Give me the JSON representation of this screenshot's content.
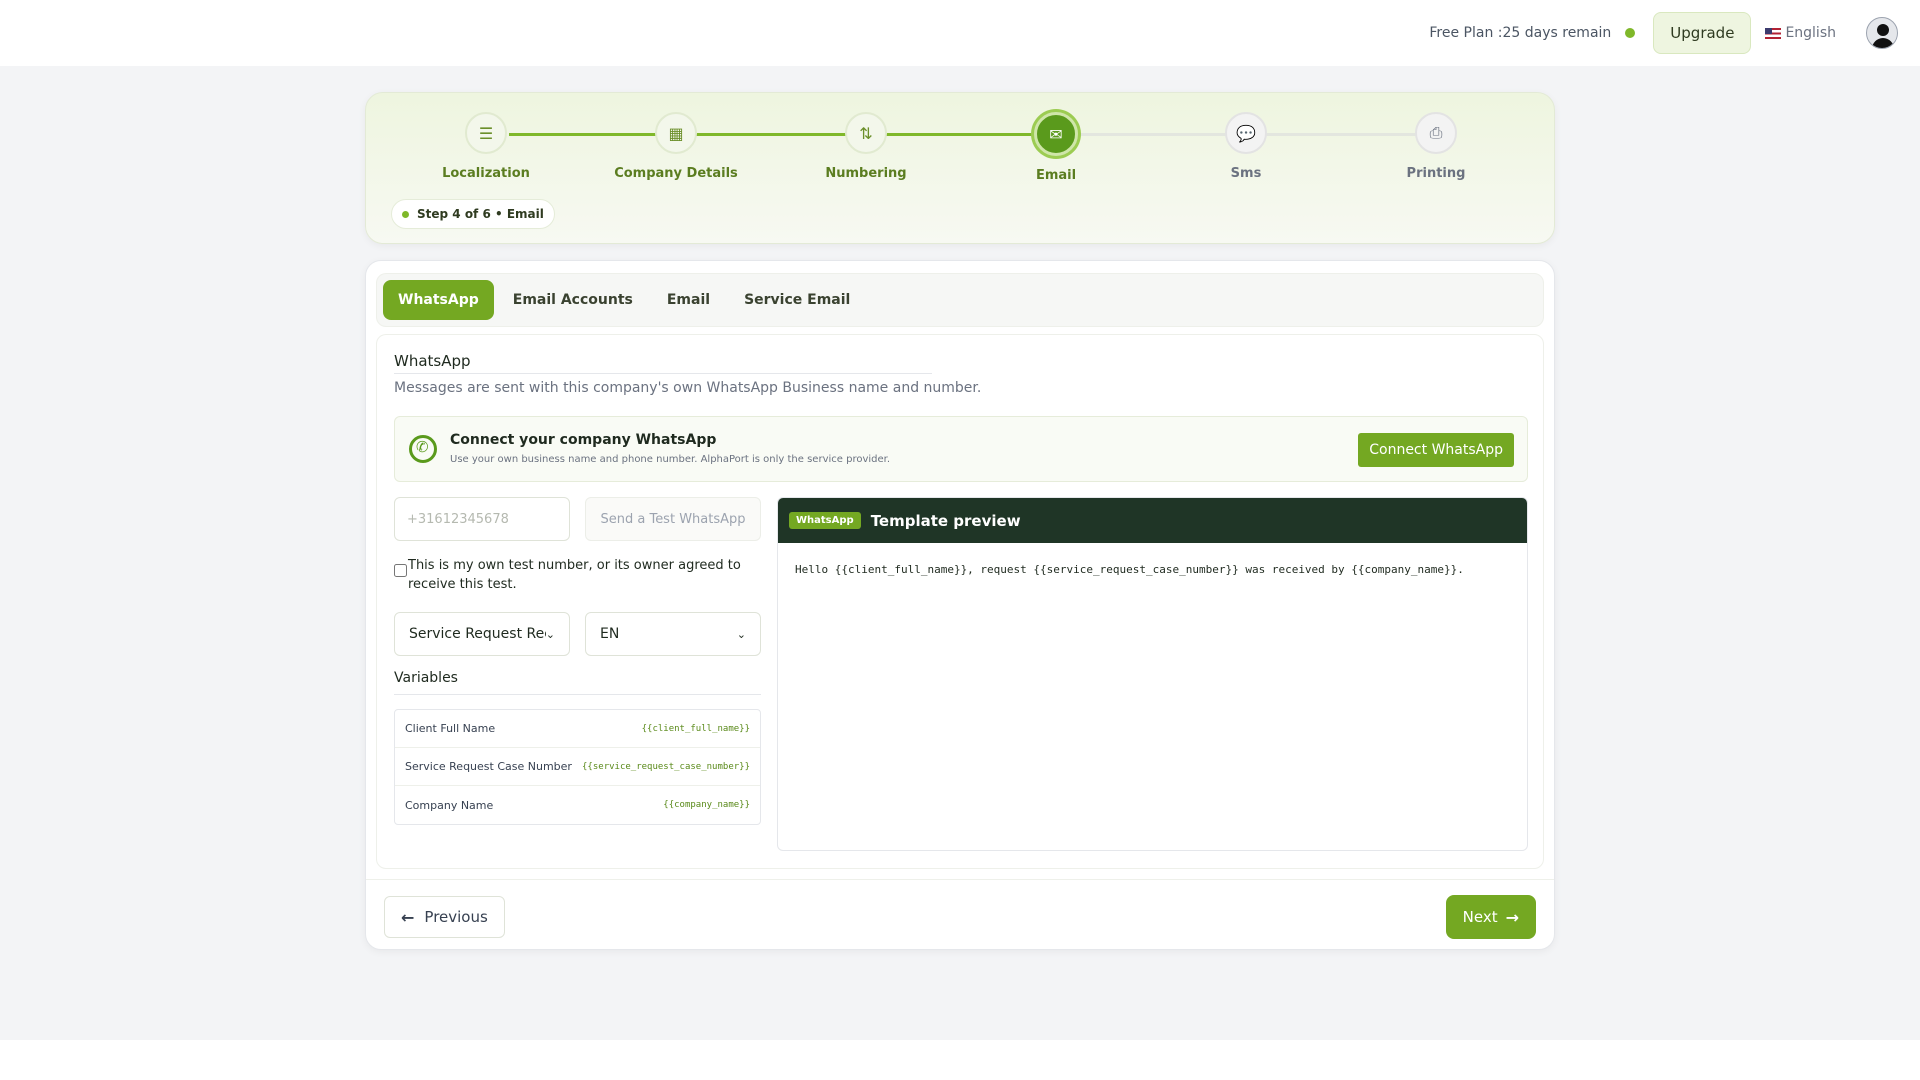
{
  "header": {
    "plan_text": "Free Plan :25 days remain",
    "upgrade_label": "Upgrade",
    "language": "English"
  },
  "stepper": {
    "steps": [
      {
        "label": "Localization",
        "icon": "sliders-icon",
        "glyph": "☰",
        "status": "done"
      },
      {
        "label": "Company Details",
        "icon": "building-icon",
        "glyph": "▦",
        "status": "done"
      },
      {
        "label": "Numbering",
        "icon": "sort-numbers-icon",
        "glyph": "⇅",
        "status": "done"
      },
      {
        "label": "Email",
        "icon": "envelope-icon",
        "glyph": "✉",
        "status": "active"
      },
      {
        "label": "Sms",
        "icon": "chat-icon",
        "glyph": "💬",
        "status": "pending"
      },
      {
        "label": "Printing",
        "icon": "printer-icon",
        "glyph": "⎙",
        "status": "pending"
      }
    ],
    "pill_text": "Step 4 of 6 •  Email"
  },
  "tabs": [
    "WhatsApp",
    "Email Accounts",
    "Email",
    "Service Email"
  ],
  "section": {
    "title": "WhatsApp",
    "subtitle": "Messages are sent with this company's own WhatsApp Business name and number."
  },
  "connect": {
    "title": "Connect your company WhatsApp",
    "subtitle": "Use your own business name and phone number. AlphaPort is only the service provider.",
    "button_label": "Connect WhatsApp"
  },
  "test": {
    "phone_placeholder": "+31612345678",
    "send_label": "Send a Test WhatsApp",
    "consent": "This is my own test number, or its owner agreed to receive this test."
  },
  "selects": {
    "template": "Service Request Rec",
    "language": "EN"
  },
  "variables": {
    "title": "Variables",
    "rows": [
      {
        "label": "Client Full Name",
        "token": "{{client_full_name}}"
      },
      {
        "label": "Service Request Case Number",
        "token": "{{service_request_case_number}}"
      },
      {
        "label": "Company Name",
        "token": "{{company_name}}"
      }
    ]
  },
  "preview": {
    "badge": "WhatsApp",
    "title": "Template preview",
    "body": "Hello {{client_full_name}}, request {{service_request_case_number}} was received by {{company_name}}."
  },
  "nav": {
    "previous_label": "Previous",
    "next_label": "Next"
  },
  "colors": {
    "accent": "#74a822",
    "active_step": "#5a9a1c",
    "preview_header": "#1f3526"
  }
}
